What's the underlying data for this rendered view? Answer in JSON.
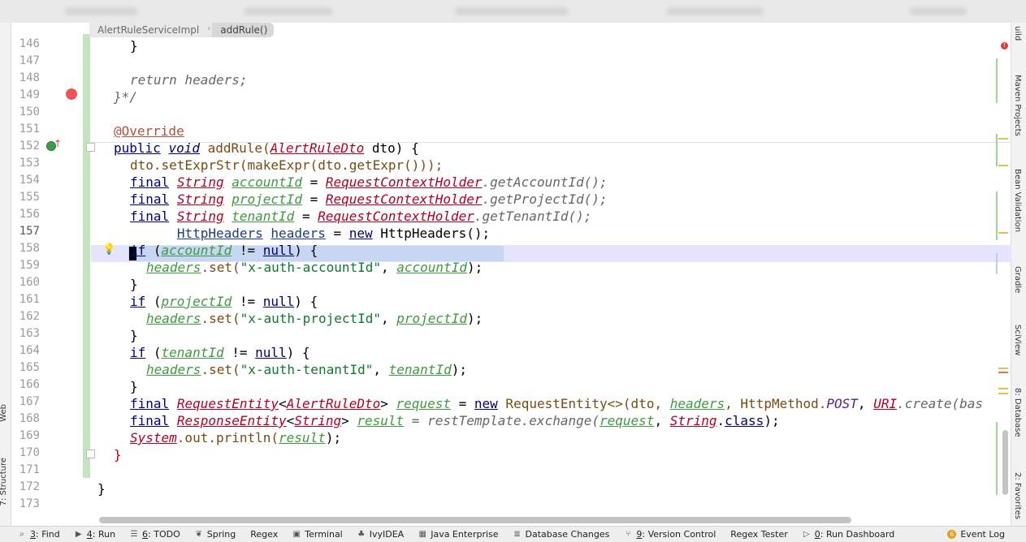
{
  "breadcrumb": {
    "class_name": "AlertRuleServiceImpl",
    "method_name": "addRule()"
  },
  "left_tools": {
    "web": "Web",
    "structure": "7: Structure"
  },
  "right_tools": {
    "build": "uild",
    "maven": "Maven Projects",
    "bean": "Bean Validation",
    "gradle": "Gradle",
    "sciview": "SciView",
    "database": "8: Database",
    "favorites": "2: Favorites"
  },
  "line_numbers": [
    "146",
    "147",
    "148",
    "149",
    "150",
    "151",
    "152",
    "153",
    "154",
    "155",
    "156",
    "157",
    "158",
    "159",
    "160",
    "161",
    "162",
    "163",
    "164",
    "165",
    "166",
    "167",
    "168",
    "169",
    "170",
    "171",
    "172",
    "173"
  ],
  "code": {
    "l146": "}",
    "l148": "return headers;",
    "l149": "}*/",
    "l151": "@Override",
    "l152_kw1": "public",
    "l152_kw2": "void",
    "l152_m": "addRule(",
    "l152_t": "AlertRuleDto",
    "l152_rest": " dto) {",
    "l153": "dto.setExprStr(makeExpr(dto.getExpr()));",
    "kw_final": "final",
    "kw_string": "String",
    "kw_if": "if",
    "kw_null": "null",
    "kw_new": "new",
    "v_account": "accountId",
    "v_project": "projectId",
    "v_tenant": "tenantId",
    "v_headers": "headers",
    "rch": "RequestContextHolder",
    "get_account": ".getAccountId();",
    "get_project": ".getProjectId();",
    "get_tenant": ".getTenantId();",
    "eq": " = ",
    "neq": " != ",
    "open_if": " (",
    "close_if": ") {",
    "brace_close": "}",
    "l157_type": "HttpHeaders",
    "l157_rest": " HttpHeaders();",
    "set_call": ".set(",
    "s_account": "\"x-auth-accountId\"",
    "s_project": "\"x-auth-projectId\"",
    "s_tenant": "\"x-auth-tenantId\"",
    "comma": ", ",
    "end_call": ");",
    "l167_type": "RequestEntity",
    "l167_generic": "AlertRuleDto",
    "l167_var": "request",
    "l167_ctor": " RequestEntity<>(dto, ",
    "l167_tail1": ", HttpMethod.",
    "l167_post": "POST",
    "l167_comma": ", ",
    "l167_uri": "URI",
    "l167_tail2": ".create(bas",
    "l168_type": "ResponseEntity",
    "l168_var": "result",
    "l168_mid": " = restTemplate.exchange(",
    "l168_class": "class",
    "l169_sys": "System",
    "l169_mid": ".out.println(",
    "l169_var": "result",
    "l170": "}",
    "l172": "}"
  },
  "status_bar": {
    "find": "Find",
    "find_num": "3",
    "run": "Run",
    "run_num": "4",
    "todo": "TODO",
    "todo_num": "6",
    "spring": "Spring",
    "regex": "Regex",
    "terminal": "Terminal",
    "ivy": "IvyIDEA",
    "java_ent": "Java Enterprise",
    "db_changes": "Database Changes",
    "vc": "Version Control",
    "vc_num": "9",
    "regex_tester": "Regex Tester",
    "run_dash": "Run Dashboard",
    "run_dash_num": "0",
    "event_log": "Event Log",
    "event_log_count": "6"
  }
}
